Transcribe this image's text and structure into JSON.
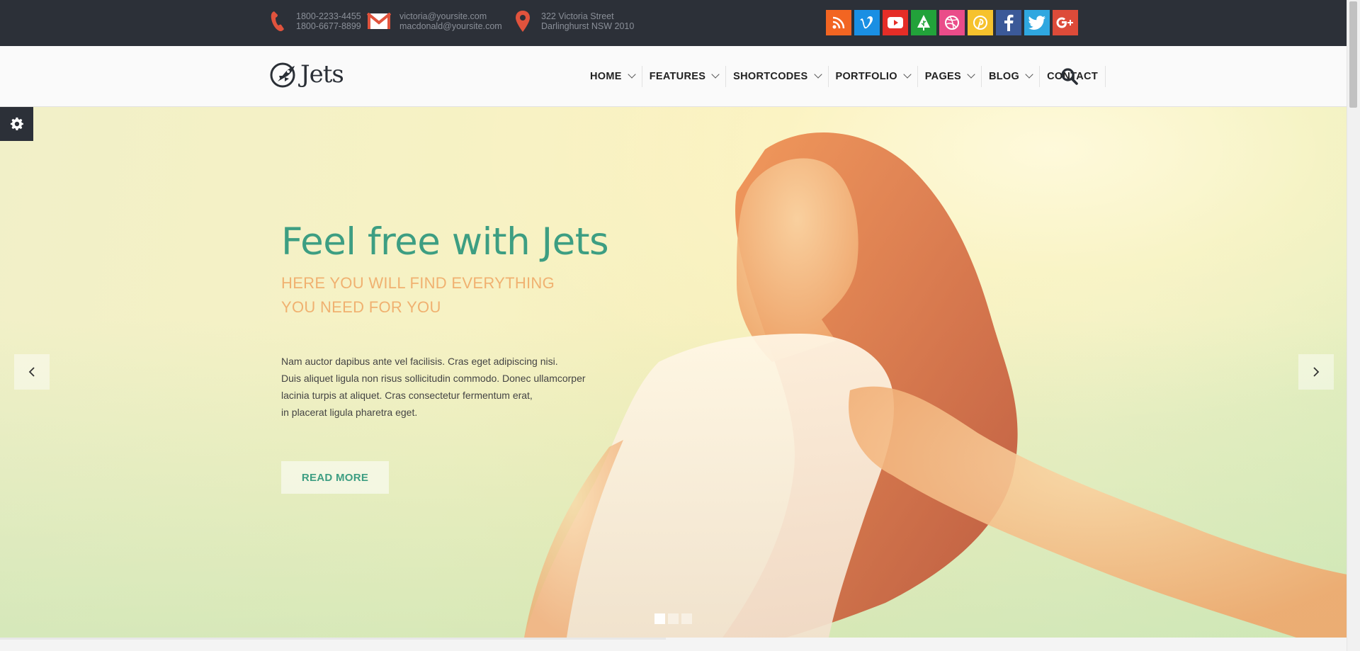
{
  "topbar": {
    "phone": {
      "icon": "phone-icon",
      "line1": "1800-2233-4455",
      "line2": "1800-6677-8899"
    },
    "email": {
      "icon": "mail-icon",
      "line1": "victoria@yoursite.com",
      "line2": "macdonald@yoursite.com"
    },
    "address": {
      "icon": "map-pin-icon",
      "line1": "322 Victoria Street",
      "line2": "Darlinghurst NSW 2010"
    },
    "socials": [
      {
        "name": "rss",
        "glyph": "",
        "color": "#f26522"
      },
      {
        "name": "vimeo",
        "glyph": "v",
        "color": "#1a8fe3"
      },
      {
        "name": "youtube",
        "glyph": "",
        "color": "#e52d27"
      },
      {
        "name": "forrst",
        "glyph": "",
        "color": "#22a23a"
      },
      {
        "name": "dribbble",
        "glyph": "",
        "color": "#ea4c89"
      },
      {
        "name": "pinterest",
        "glyph": "",
        "color": "#f6c22d"
      },
      {
        "name": "facebook",
        "glyph": "f",
        "color": "#3b5998"
      },
      {
        "name": "twitter",
        "glyph": "",
        "color": "#2fa7e0"
      },
      {
        "name": "google-plus",
        "glyph": "g+",
        "color": "#dd4b39"
      }
    ]
  },
  "header": {
    "logo_text": "Jets",
    "nav": [
      {
        "label": "HOME",
        "dropdown": true
      },
      {
        "label": "FEATURES",
        "dropdown": true
      },
      {
        "label": "SHORTCODES",
        "dropdown": true
      },
      {
        "label": "PORTFOLIO",
        "dropdown": true
      },
      {
        "label": "PAGES",
        "dropdown": true
      },
      {
        "label": "BLOG",
        "dropdown": true
      },
      {
        "label": "CONTACT",
        "dropdown": false
      }
    ]
  },
  "hero": {
    "title": "Feel free with Jets",
    "subtitle_line1": "HERE YOU WILL FIND EVERYTHING",
    "subtitle_line2": "YOU NEED FOR YOU",
    "body_line1": "Nam auctor dapibus ante vel facilisis. Cras eget adipiscing nisi.",
    "body_line2": "Duis aliquet ligula non risus sollicitudin commodo. Donec ullamcorper",
    "body_line3": "lacinia turpis at aliquet. Cras consectetur fermentum erat,",
    "body_line4": "in placerat ligula pharetra eget.",
    "button_label": "READ MORE",
    "slides": 3,
    "active_slide": 1
  },
  "colors": {
    "accent": "#3d9e82",
    "subtitle": "#f0b170",
    "dark": "#2c3038"
  }
}
